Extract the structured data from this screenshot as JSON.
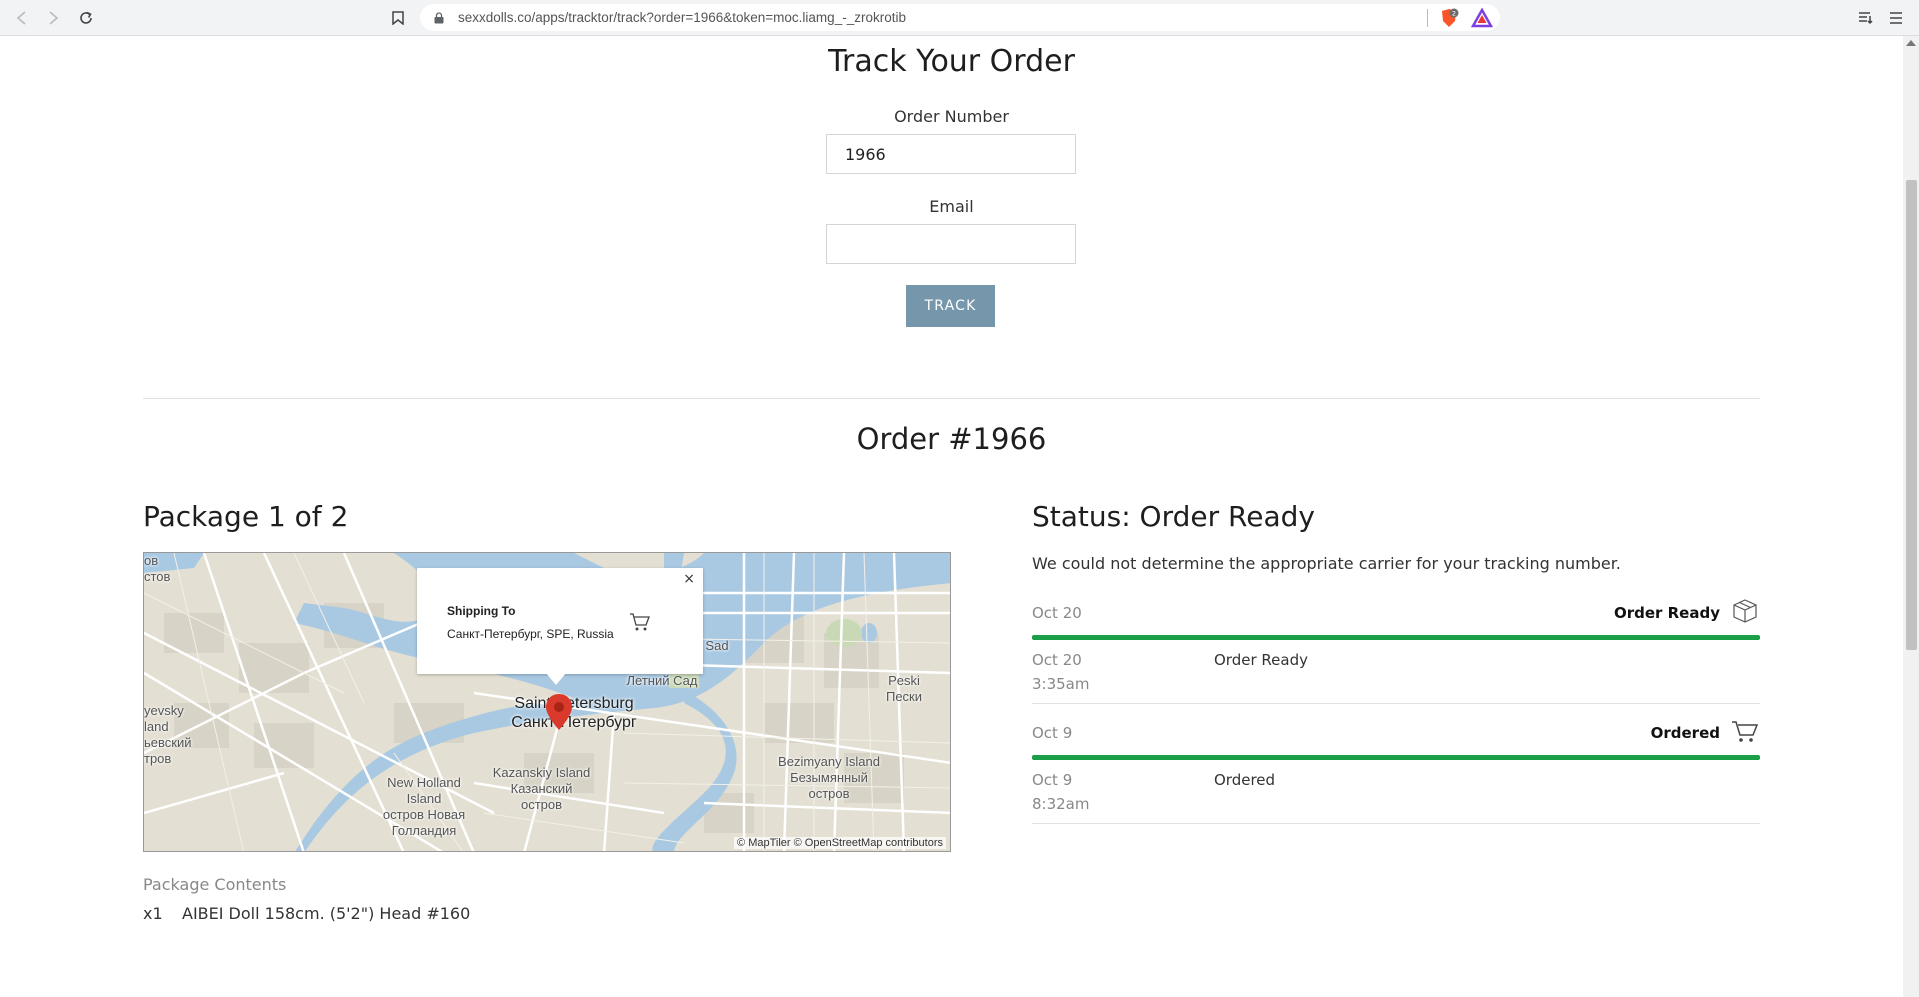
{
  "browser": {
    "url": "sexxdolls.co/apps/tracktor/track?order=1966&token=moc.liamg_-_zrokrotib",
    "back_icon": "back-arrow-icon",
    "forward_icon": "forward-arrow-icon",
    "reload_icon": "reload-icon",
    "bookmark_icon": "bookmark-icon",
    "lock_icon": "lock-icon",
    "brave_badge": "2"
  },
  "form": {
    "title": "Track Your Order",
    "order_label": "Order Number",
    "order_value": "1966",
    "email_label": "Email",
    "email_value": "",
    "track_button": "TRACK"
  },
  "order": {
    "title": "Order #1966"
  },
  "package": {
    "title": "Package 1 of 2",
    "map": {
      "popup_close": "×",
      "popup_title": "Shipping To",
      "popup_address": "Санкт-Петербург, SPE, Russia",
      "attribution": "© MapTiler © OpenStreetMap contributors",
      "labels": {
        "city_en": "Saint Petersburg",
        "city_ru": "Санкт-Петербург",
        "kazansky": "Kazanskiy Island\nКазанский\nостров",
        "new_holland": "New Holland\nIsland\nостров Новая\nГолландия",
        "bezimyany": "Bezimyany Island\nБезымянный\nостров",
        "peski": "Peski\nПески",
        "letny": "Летний Сад",
        "sad": "Sad",
        "top_left": "ов\nстов",
        "left_island": "yevsky\nland\nьевский\nтров"
      }
    },
    "contents_label": "Package Contents",
    "items": [
      {
        "qty": "x1",
        "name": "AIBEI Doll 158cm. (5'2\") Head #160"
      }
    ]
  },
  "status": {
    "title": "Status: Order Ready",
    "message": "We could not determine the appropriate carrier for your tracking number.",
    "accent_color": "#1a9e48",
    "groups": [
      {
        "date": "Oct 20",
        "status": "Order Ready",
        "icon": "package-box-icon",
        "events": [
          {
            "date": "Oct 20",
            "time": "3:35am",
            "description": "Order Ready"
          }
        ]
      },
      {
        "date": "Oct 9",
        "status": "Ordered",
        "icon": "shopping-cart-icon",
        "events": [
          {
            "date": "Oct 9",
            "time": "8:32am",
            "description": "Ordered"
          }
        ]
      }
    ]
  }
}
